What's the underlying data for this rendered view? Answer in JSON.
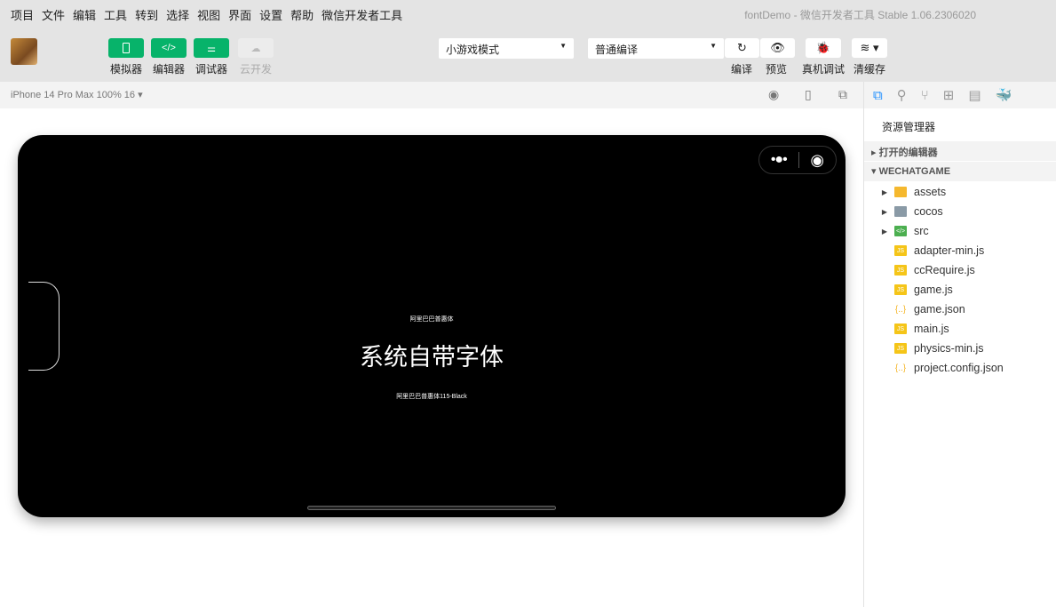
{
  "menu": [
    "项目",
    "文件",
    "编辑",
    "工具",
    "转到",
    "选择",
    "视图",
    "界面",
    "设置",
    "帮助",
    "微信开发者工具"
  ],
  "window_title": "fontDemo - 微信开发者工具 Stable 1.06.2306020",
  "toolbar": {
    "simulator": "模拟器",
    "editor": "编辑器",
    "debugger": "调试器",
    "cloud": "云开发",
    "mode": "小游戏模式",
    "compile_mode": "普通编译",
    "compile": "编译",
    "preview": "预览",
    "real_debug": "真机调试",
    "clear_cache": "清缓存"
  },
  "device": "iPhone 14 Pro Max 100% 16 ▾",
  "explorer": {
    "title": "资源管理器",
    "open_editors": "打开的编辑器",
    "project": "WECHATGAME",
    "files": [
      {
        "name": "assets",
        "type": "folder"
      },
      {
        "name": "cocos",
        "type": "folder"
      },
      {
        "name": "src",
        "type": "folder"
      },
      {
        "name": "adapter-min.js",
        "type": "js"
      },
      {
        "name": "ccRequire.js",
        "type": "js"
      },
      {
        "name": "game.js",
        "type": "js"
      },
      {
        "name": "game.json",
        "type": "json"
      },
      {
        "name": "main.js",
        "type": "js"
      },
      {
        "name": "physics-min.js",
        "type": "js"
      },
      {
        "name": "project.config.json",
        "type": "json"
      }
    ]
  },
  "game": {
    "line1": "阿里巴巴普惠体",
    "line2": "系统自带字体",
    "line3": "阿里巴巴普惠体115-Black"
  },
  "colors": {
    "accent": "#07b36a"
  }
}
